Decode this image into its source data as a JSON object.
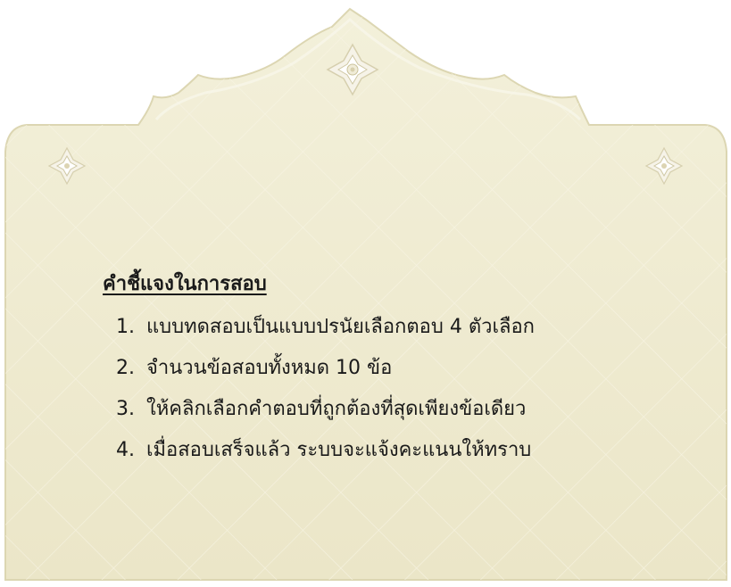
{
  "panel": {
    "background_color": "#eeead0",
    "border_color": "#d8d3ae",
    "ornament_color": "#f5f2e6"
  },
  "instructions": {
    "heading": "คำชี้แจงในการสอบ",
    "items": [
      {
        "number": "1.",
        "text": "แบบทดสอบเป็นแบบปรนัยเลือกตอบ 4 ตัวเลือก"
      },
      {
        "number": "2.",
        "text": "จำนวนข้อสอบทั้งหมด 10 ข้อ"
      },
      {
        "number": "3.",
        "text": "ให้คลิกเลือกคำตอบที่ถูกต้องที่สุดเพียงข้อเดียว"
      },
      {
        "number": "4.",
        "text": "เมื่อสอบเสร็จแล้ว ระบบจะแจ้งคะแนนให้ทราบ"
      }
    ]
  }
}
